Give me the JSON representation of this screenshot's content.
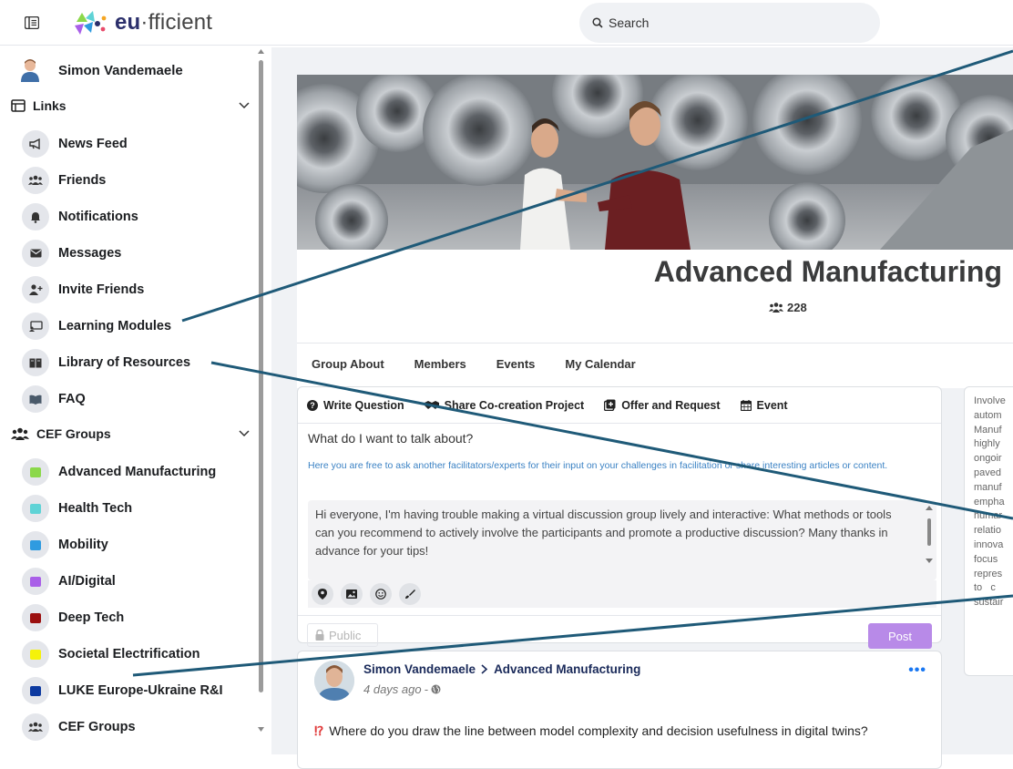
{
  "header": {
    "logo_text_bold": "eu",
    "logo_text_light": "fficient",
    "search_placeholder": "Search"
  },
  "sidebar": {
    "profile_name": "Simon Vandemaele",
    "links_section": "Links",
    "links": [
      {
        "label": "News Feed",
        "icon": "megaphone-icon"
      },
      {
        "label": "Friends",
        "icon": "friends-icon"
      },
      {
        "label": "Notifications",
        "icon": "bell-icon"
      },
      {
        "label": "Messages",
        "icon": "envelope-icon"
      },
      {
        "label": "Invite Friends",
        "icon": "user-plus-icon"
      },
      {
        "label": "Learning Modules",
        "icon": "presentation-icon"
      },
      {
        "label": "Library of Resources",
        "icon": "book-icon"
      },
      {
        "label": "FAQ",
        "icon": "open-book-icon"
      }
    ],
    "groups_section": "CEF Groups",
    "groups": [
      {
        "label": "Advanced Manufacturing",
        "color": "#8bd84a"
      },
      {
        "label": "Health Tech",
        "color": "#5fd3d6"
      },
      {
        "label": "Mobility",
        "color": "#2f9be0"
      },
      {
        "label": "AI/Digital",
        "color": "#a95fe8"
      },
      {
        "label": "Deep Tech",
        "color": "#9b1010"
      },
      {
        "label": "Societal Electrification",
        "color": "#f5f20a"
      },
      {
        "label": "LUKE Europe-Ukraine R&I",
        "color": "#0d3aa0"
      },
      {
        "label": "CEF Groups",
        "color": ""
      }
    ]
  },
  "group": {
    "title": "Advanced Manufacturing",
    "member_count": "228",
    "tabs": [
      "Group About",
      "Members",
      "Events",
      "My Calendar"
    ]
  },
  "composer": {
    "tabs": [
      "Write Question",
      "Share Co-creation Project",
      "Offer and Request",
      "Event"
    ],
    "question": "What do I want to talk about?",
    "hint": "Here you are free to ask another facilitators/experts for their input on your challenges in facilitation or share interesting articles or content.",
    "draft": "Hi everyone, I'm having trouble making a virtual discussion group lively and interactive: What methods or tools can you recommend to actively involve the participants and promote a productive discussion? Many thanks in advance for your tips!",
    "privacy": "Public",
    "post_label": "Post"
  },
  "post": {
    "author": "Simon Vandemaele",
    "group": "Advanced Manufacturing",
    "time": "4 days ago",
    "text": "Where do you draw the line between model complexity and decision usefulness in digital twins?"
  },
  "about": {
    "lines": [
      "Involve",
      "autom",
      "Manuf",
      "highly",
      "ongoir",
      "paved",
      "manuf",
      "empha",
      "humar",
      "relatio",
      "innova",
      "focus",
      "repres",
      "to   c",
      "sustair"
    ]
  },
  "colors": {
    "accent": "#b88ae8",
    "annotation_line": "#1f5a78",
    "link_blue": "#3b82c4"
  }
}
